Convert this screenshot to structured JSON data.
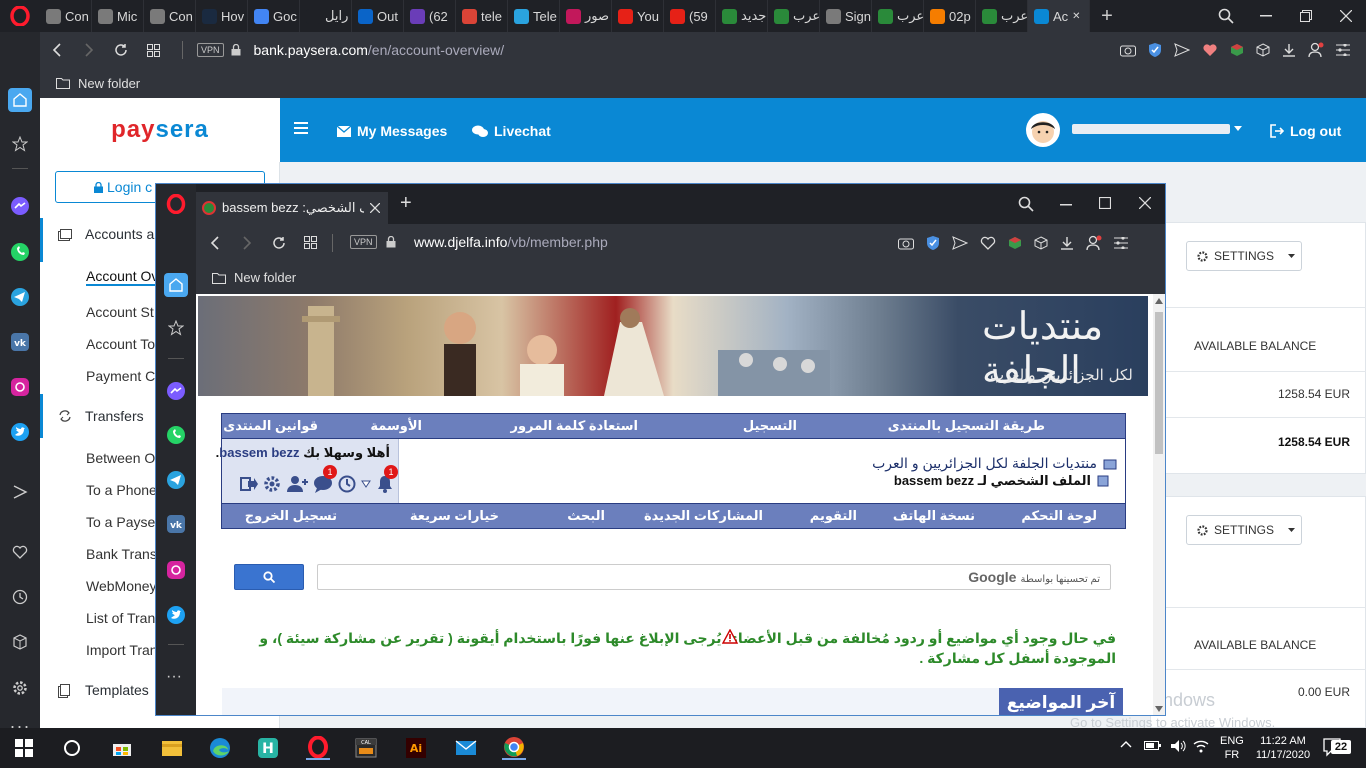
{
  "outer_browser": {
    "tabs": [
      {
        "label": "Con",
        "icon": "doc-icon",
        "color": "#7a7a7a"
      },
      {
        "label": "Mic",
        "icon": "doc-icon",
        "color": "#7a7a7a"
      },
      {
        "label": "Con",
        "icon": "doc-icon",
        "color": "#7a7a7a"
      },
      {
        "label": "Hov",
        "icon": "dark-icon",
        "color": "#1a2a40"
      },
      {
        "label": "Goc",
        "icon": "google-icon",
        "color": "#4285f4"
      },
      {
        "label": "رايل",
        "icon": "star-icon",
        "color": "#1f2126"
      },
      {
        "label": "Out",
        "icon": "outlook-icon",
        "color": "#0a64c8"
      },
      {
        "label": "(62",
        "icon": "mail-icon",
        "color": "#6a3db8"
      },
      {
        "label": "tele",
        "icon": "google-icon",
        "color": "#db4437"
      },
      {
        "label": "Tele",
        "icon": "telegram-icon",
        "color": "#2aa3df"
      },
      {
        "label": "صور",
        "icon": "wave-icon",
        "color": "#c2185b"
      },
      {
        "label": "You",
        "icon": "youtube-icon",
        "color": "#e62117"
      },
      {
        "label": "(59",
        "icon": "youtube-icon",
        "color": "#e62117"
      },
      {
        "label": "جديد",
        "icon": "forum-icon",
        "color": "#2a8a3a"
      },
      {
        "label": "عرب",
        "icon": "forum-icon",
        "color": "#2a8a3a"
      },
      {
        "label": "Sign",
        "icon": "doc-icon",
        "color": "#7a7a7a"
      },
      {
        "label": "عرب",
        "icon": "forum-icon",
        "color": "#2a8a3a"
      },
      {
        "label": "02p",
        "icon": "blogger-icon",
        "color": "#f57d00"
      },
      {
        "label": "عرب",
        "icon": "forum-icon",
        "color": "#2a8a3a"
      },
      {
        "label": "Ac",
        "icon": "paysera-icon",
        "color": "#0a88d4"
      }
    ],
    "url_host": "bank.paysera.com",
    "url_path": "/en/account-overview/",
    "vpn": "VPN",
    "bookmark": "New folder"
  },
  "paysera": {
    "logo": "paysera",
    "nav": {
      "messages": "My Messages",
      "livechat": "Livechat",
      "logout": "Log out"
    },
    "login_button": "Login c",
    "sidebar": {
      "accounts_title": "Accounts a",
      "account_items": [
        "Account Ov",
        "Account St",
        "Account To",
        "Payment C"
      ],
      "transfers_title": "Transfers",
      "transfer_items": [
        "Between O",
        "To a Phone",
        "To a Payse",
        "Bank Trans",
        "WebMoney",
        "List of Tran",
        "Import Tran"
      ],
      "templates_title": "Templates"
    },
    "card1": {
      "settings": "SETTINGS",
      "balance_label": "AVAILABLE BALANCE",
      "balance1": "1258.54 EUR",
      "balance2": "1258.54 EUR"
    },
    "card2": {
      "settings": "SETTINGS",
      "balance_label": "AVAILABLE BALANCE",
      "balance1": "0.00 EUR"
    },
    "watermark1": "Activate Windows",
    "watermark2": "Go to Settings to activate Windows."
  },
  "inner_browser": {
    "tab_title": "bassem bezz :الملف الشخصي",
    "url_host": "www.djelfa.info",
    "url_path": "/vb/member.php",
    "vpn": "VPN",
    "bookmark": "New folder"
  },
  "djelfa": {
    "banner_title": "منتديات الجلفة",
    "banner_subtitle": "لكل الجزائريين والعرب",
    "top_nav": [
      "طريقة التسجيل بالمنتدى",
      "التسجيل",
      "استعادة كلمة المرور",
      "الأوسمة",
      "قوانين المنتدى"
    ],
    "welcome": "أهلا وسهلا بك",
    "username": "bassem bezz",
    "notif_badge": "1",
    "msg_badge": "1",
    "breadcrumb_forum": "منتديات الجلفة لكل الجزائريين و العرب",
    "breadcrumb_page": "الملف الشخصي لـ bassem bezz",
    "bottom_nav": [
      "لوحة التحكم",
      "نسخة الهاتف",
      "التقويم",
      "المشاركات الجديدة",
      "البحث",
      "خيارات سريعة",
      "تسجيل الخروج"
    ],
    "search_brand": "Google",
    "search_caption": "تم تحسينها بواسطة",
    "notice": "في حال وجود أي مواضيع أو ردود مُخالفة من قبل الأعضاء، يُرجى الإبلاغ عنها فورًا باستخدام أيقونة ( تقرير عن مشاركة سيئة )، و الموجودة أسفل كل مشاركة .",
    "latest_topics": "آخر المواضيع"
  },
  "taskbar": {
    "lang1": "ENG",
    "lang2": "FR",
    "time": "11:22 AM",
    "date": "11/17/2020",
    "notif_count": "22"
  }
}
